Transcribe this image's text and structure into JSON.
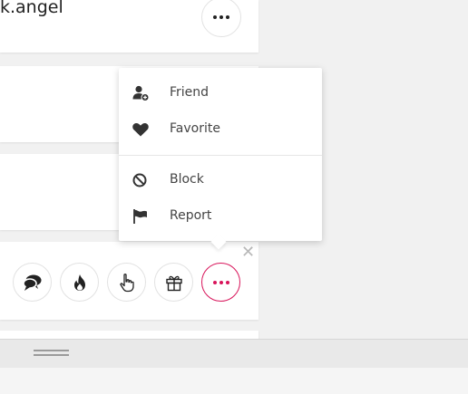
{
  "post": {
    "username": "k.angel"
  },
  "menu": {
    "items": [
      {
        "label": "Friend",
        "icon": "add-friend-icon"
      },
      {
        "label": "Favorite",
        "icon": "heart-icon"
      },
      {
        "label": "Block",
        "icon": "block-icon"
      },
      {
        "label": "Report",
        "icon": "flag-icon"
      }
    ]
  },
  "actions": [
    {
      "icon": "chat-bubbles-icon"
    },
    {
      "icon": "fire-icon"
    },
    {
      "icon": "pointing-hand-icon"
    },
    {
      "icon": "gift-icon"
    },
    {
      "icon": "more-icon",
      "active": true
    }
  ],
  "colors": {
    "accent": "#d8145a",
    "icon": "#222222",
    "close": "#b8b8b8"
  }
}
